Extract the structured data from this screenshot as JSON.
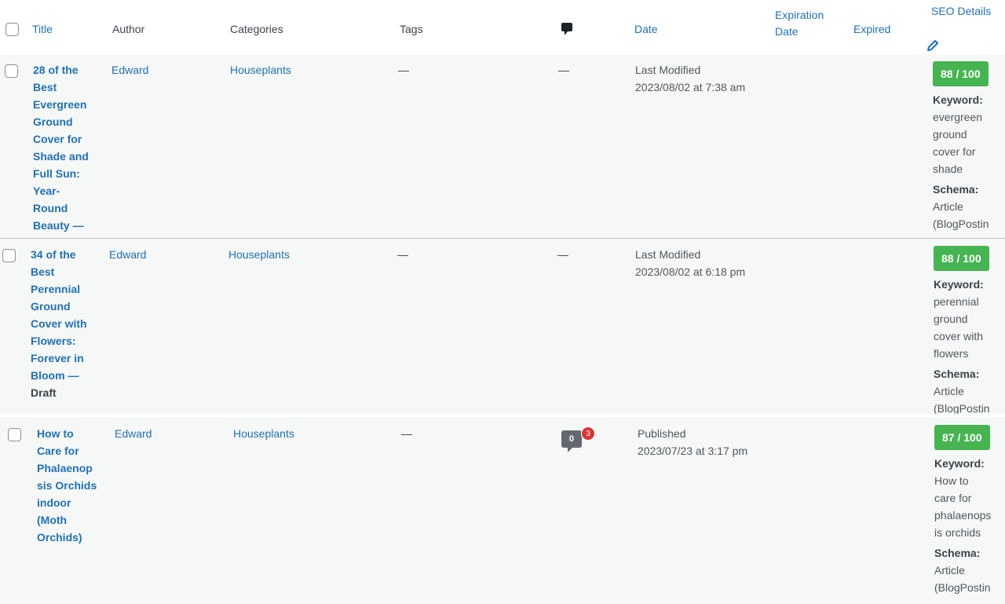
{
  "columns": {
    "title": "Title",
    "author": "Author",
    "categories": "Categories",
    "tags": "Tags",
    "comments_icon": "comment-icon",
    "date": "Date",
    "expiration_line1": "Expiration",
    "expiration_line2": "Date",
    "expired": "Expired",
    "seo_details": "SEO Details",
    "seo_edit_icon": "pencil-icon"
  },
  "rows": [
    {
      "title_lines": [
        "28 of the",
        "Best",
        "Evergreen",
        "Ground",
        "Cover for",
        "Shade and",
        "Full Sun:",
        "Year-",
        "Round",
        "Beauty —"
      ],
      "title": "28 of the Best Evergreen Ground Cover for Shade and Full Sun: Year-Round Beauty",
      "status": "",
      "author": "Edward",
      "category": "Houseplants",
      "tags": "—",
      "comments": "—",
      "date_label": "Last Modified",
      "date_value": "2023/08/02 at 7:38 am",
      "seo_score": "88 / 100",
      "keyword_label": "Keyword:",
      "keyword_lines": [
        "evergreen",
        "ground",
        "cover for",
        "shade"
      ],
      "schema_label": "Schema:",
      "schema_lines": [
        "Article",
        "(BlogPostin"
      ]
    },
    {
      "title_lines": [
        "34 of the",
        "Best",
        "Perennial",
        "Ground",
        "Cover with",
        "Flowers:",
        "Forever in",
        "Bloom —"
      ],
      "title": "34 of the Best Perennial Ground Cover with Flowers: Forever in Bloom",
      "status": "Draft",
      "author": "Edward",
      "category": "Houseplants",
      "tags": "—",
      "comments": "—",
      "date_label": "Last Modified",
      "date_value": "2023/08/02 at 6:18 pm",
      "seo_score": "88 / 100",
      "keyword_label": "Keyword:",
      "keyword_lines": [
        "perennial",
        "ground",
        "cover with",
        "flowers"
      ],
      "schema_label": "Schema:",
      "schema_lines": [
        "Article",
        "(BlogPostin"
      ]
    },
    {
      "title_lines": [
        "How to",
        "Care for",
        "Phalaenop",
        "sis Orchids",
        "indoor",
        "(Moth",
        "Orchids)"
      ],
      "title": "How to Care for Phalaenopsis Orchids indoor (Moth Orchids)",
      "status": "",
      "author": "Edward",
      "category": "Houseplants",
      "tags": "—",
      "comments_approved": "0",
      "comments_pending": "3",
      "date_label": "Published",
      "date_value": "2023/07/23 at 3:17 pm",
      "seo_score": "87 / 100",
      "keyword_label": "Keyword:",
      "keyword_lines": [
        "How to",
        "care for",
        "phalaenops",
        "is orchids"
      ],
      "schema_label": "Schema:",
      "schema_lines": [
        "Article",
        "(BlogPostin"
      ]
    }
  ],
  "colors": {
    "link": "#2271b1",
    "score_good": "#46b450",
    "pending_badge": "#d63638",
    "row_bg": "#f6f7f7"
  }
}
